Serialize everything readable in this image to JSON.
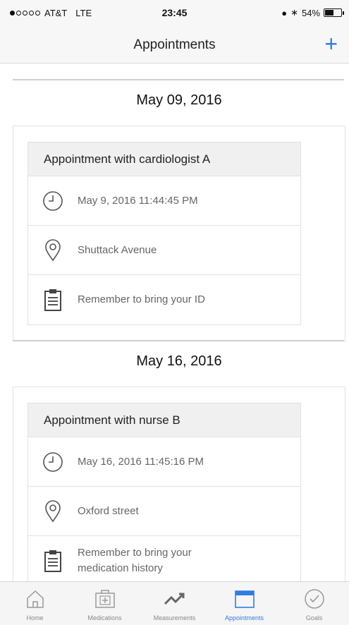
{
  "status_bar": {
    "carrier": "AT&T",
    "network": "LTE",
    "time": "23:45",
    "battery": "54%",
    "battery_level": 0.54
  },
  "nav": {
    "title": "Appointments",
    "add_icon": "plus-icon"
  },
  "appointments": [
    {
      "date": "May 09, 2016",
      "title": "Appointment with cardiologist A",
      "datetime": "May 9, 2016 11:44:45 PM",
      "location": "Shuttack Avenue",
      "note": "Remember to bring your ID"
    },
    {
      "date": "May 16, 2016",
      "title": "Appointment with nurse B",
      "datetime": "May 16, 2016 11:45:16 PM",
      "location": "Oxford street",
      "note": "Remember to bring your medication history"
    }
  ],
  "tabs": [
    {
      "label": "Home",
      "icon": "home-icon",
      "active": false
    },
    {
      "label": "Medications",
      "icon": "medical-kit-icon",
      "active": false
    },
    {
      "label": "Measurements",
      "icon": "trend-icon",
      "active": false
    },
    {
      "label": "Appointments",
      "icon": "calendar-icon",
      "active": true
    },
    {
      "label": "Goals",
      "icon": "checkmark-circle-icon",
      "active": false
    }
  ],
  "colors": {
    "accent": "#2f7de1",
    "card_header": "#f0f0f0",
    "border": "#e2e2e2"
  }
}
